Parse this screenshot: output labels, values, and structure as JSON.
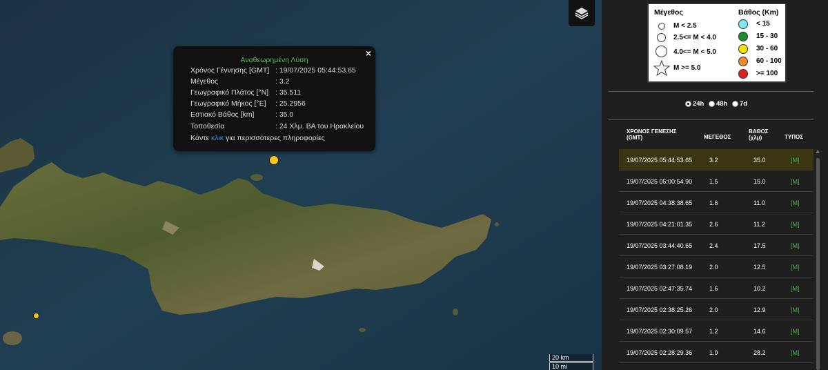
{
  "popup": {
    "title": "Αναθεωρημένη Λύση",
    "close": "×",
    "rows": [
      {
        "label": "Χρόνος Γέννησης [GMT]",
        "value": ": 19/07/2025 05:44:53.65"
      },
      {
        "label": "Μέγεθος",
        "value": ": 3.2"
      },
      {
        "label": "Γεωγραφικό Πλάτος [°N]",
        "value": ": 35.511"
      },
      {
        "label": "Γεωγραφικό Μήκος [°E]",
        "value": ": 25.2956"
      },
      {
        "label": "Εστιακό Βάθος [km]",
        "value": ": 35.0"
      },
      {
        "label": "Τοποθεσία",
        "value": ": 24 Χλμ. ΒΑ του Ηρακλείου"
      }
    ],
    "more_prefix": "Κάντε ",
    "more_link": "κλικ",
    "more_suffix": " για περισσότερες πληροφορίες"
  },
  "scale": {
    "km": "20 km",
    "mi": "10 mi"
  },
  "legend": {
    "mag_title": "Μέγεθος",
    "depth_title": "Βάθος (Km)",
    "mag_items": [
      "M < 2.5",
      "2.5<= M < 4.0",
      "4.0<= M < 5.0",
      "M >= 5.0"
    ],
    "depth_items": [
      {
        "label": "< 15",
        "color": "#7fe7ef"
      },
      {
        "label": "15 - 30",
        "color": "#1a8a2a"
      },
      {
        "label": "30 - 60",
        "color": "#f5e300"
      },
      {
        "label": "60 - 100",
        "color": "#f08a2c"
      },
      {
        "label": ">= 100",
        "color": "#e0201c"
      }
    ]
  },
  "periods": [
    "24h",
    "48h",
    "7d"
  ],
  "table": {
    "headers": {
      "time": "ΧΡΟΝΟΣ ΓΕΝΕΣΗΣ (GMT)",
      "mag": "ΜΕΓΕΘΟΣ",
      "depth": "ΒΑΘΟΣ (χλμ)",
      "type": "ΤΥΠΟΣ"
    },
    "rows": [
      [
        "19/07/2025 05:44:53.65",
        "3.2",
        "35.0",
        "[M]"
      ],
      [
        "19/07/2025 05:00:54.90",
        "1.5",
        "15.0",
        "[M]"
      ],
      [
        "19/07/2025 04:38:38.65",
        "1.6",
        "11.0",
        "[M]"
      ],
      [
        "19/07/2025 04:21:01.35",
        "2.6",
        "11.2",
        "[M]"
      ],
      [
        "19/07/2025 03:44:40.65",
        "2.4",
        "17.5",
        "[M]"
      ],
      [
        "19/07/2025 03:27:08.19",
        "2.0",
        "12.5",
        "[M]"
      ],
      [
        "19/07/2025 02:47:35.74",
        "1.6",
        "10.2",
        "[M]"
      ],
      [
        "19/07/2025 02:38:25.26",
        "2.0",
        "12.9",
        "[M]"
      ],
      [
        "19/07/2025 02:30:09.57",
        "1.2",
        "14.6",
        "[M]"
      ],
      [
        "19/07/2025 02:28:29.36",
        "1.9",
        "28.2",
        "[M]"
      ]
    ]
  },
  "colors": {
    "selected_row": "#3c3512",
    "popup_title": "#5cb85c",
    "link": "#3a8fd4",
    "type": "#4caf50",
    "quake_yellow": "#f5c518"
  }
}
